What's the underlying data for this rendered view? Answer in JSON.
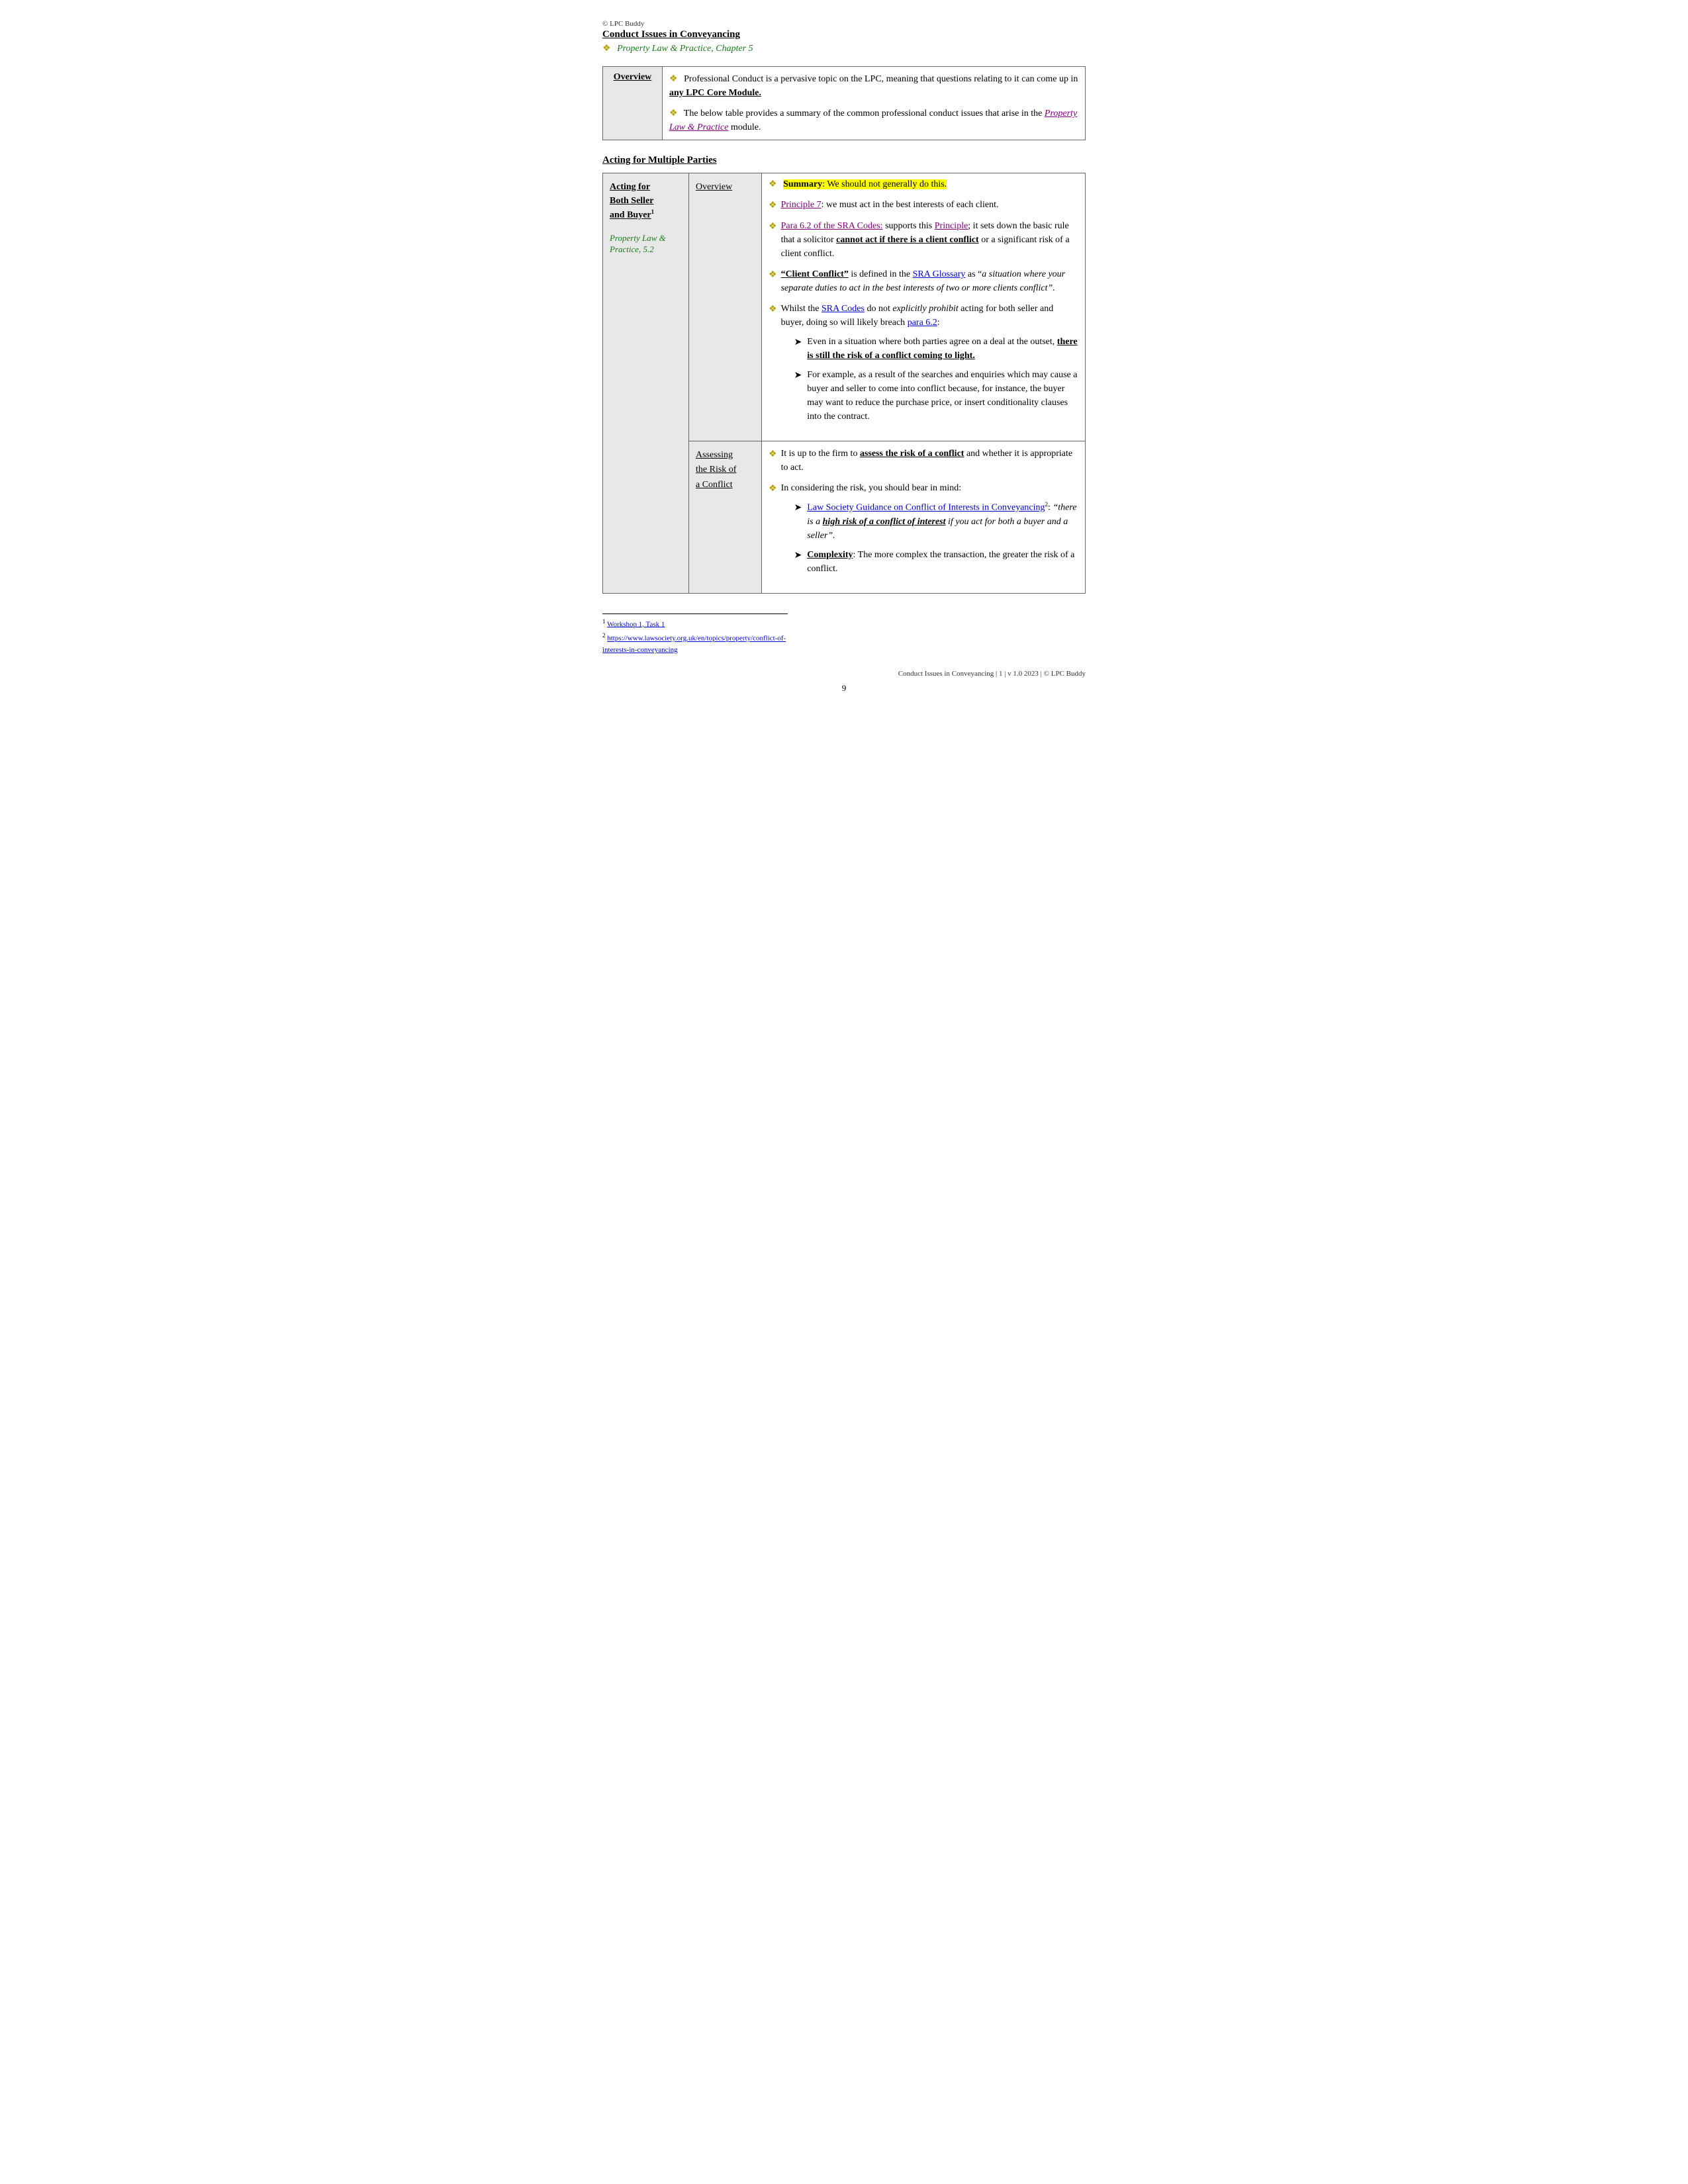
{
  "copyright": "© LPC Buddy",
  "main_title": "Conduct Issues in Conveyancing",
  "subtitle": {
    "bullet": "❖",
    "link_text": "Property Law & Practice, Chapter 5",
    "link_href": "#"
  },
  "overview": {
    "label": "Overview",
    "items": [
      {
        "text_parts": [
          {
            "text": "Professional Conduct is a pervasive topic on the LPC, meaning that questions relating to it can come up in ",
            "bold": false
          },
          {
            "text": "any LPC Core Module.",
            "bold": true,
            "underline": true
          }
        ]
      },
      {
        "text_parts": [
          {
            "text": "The below table provides a summary of the common professional conduct issues that arise in the ",
            "bold": false
          },
          {
            "text": "Property Law & Practice",
            "italic": true,
            "link": true
          },
          {
            "text": " module.",
            "bold": false
          }
        ]
      }
    ]
  },
  "acting_section_heading": "Acting for Multiple Parties",
  "table": {
    "row1": {
      "left": {
        "heading_line1": "Acting for",
        "heading_line2": "Both Seller",
        "heading_line3": "and Buyer",
        "footnote_ref": "1",
        "link_text": "Property Law & Practice, 5.2",
        "link_href": "#"
      },
      "middle_top": "Overview",
      "right_top": {
        "summary": "Summary: We should not generally do this.",
        "bullets": [
          {
            "id": "b1",
            "content": "Principle 7: we must act in the best interests of each client.",
            "link_text": "Principle 7",
            "link_href": "#"
          },
          {
            "id": "b2",
            "parts": [
              {
                "text": "Para 6.2 of the SRA Codes:",
                "link": true,
                "link_type": "purple"
              },
              {
                "text": " supports this "
              },
              {
                "text": "Principle",
                "link": true,
                "link_type": "purple"
              },
              {
                "text": "; it sets down the basic rule that a solicitor "
              },
              {
                "text": "cannot act if there is a client conflict",
                "bold": true,
                "underline": true
              },
              {
                "text": " or a significant risk of a client conflict."
              }
            ]
          },
          {
            "id": "b3",
            "parts": [
              {
                "text": "“Client Conflict”",
                "bold": true,
                "underline": true
              },
              {
                "text": " is defined in the "
              },
              {
                "text": "SRA Glossary",
                "link": true,
                "link_type": "blue"
              },
              {
                "text": " as “"
              },
              {
                "text": "a situation where your separate duties to act in the best interests of two or more clients conflict”.",
                "italic": true
              }
            ]
          },
          {
            "id": "b4",
            "parts": [
              {
                "text": "Whilst the "
              },
              {
                "text": "SRA Codes",
                "link": true,
                "link_type": "blue"
              },
              {
                "text": " do not "
              },
              {
                "text": "explicitly prohibit",
                "italic": true
              },
              {
                "text": " acting for both seller and buyer, doing so will likely breach "
              },
              {
                "text": "para 6.2",
                "link": true,
                "link_type": "blue"
              },
              {
                "text": ":"
              }
            ],
            "arrows": [
              {
                "text_parts": [
                  {
                    "text": "Even in a situation where both parties agree on a deal at the outset, "
                  },
                  {
                    "text": "there is still the risk of a conflict coming to light.",
                    "bold": true,
                    "underline": true
                  }
                ]
              },
              {
                "text_parts": [
                  {
                    "text": "For example, as a result of the searches and enquiries which may cause a buyer and seller to come into conflict because, for instance, the buyer may want to reduce the purchase price, or insert conditionality clauses into the contract."
                  }
                ]
              }
            ]
          }
        ]
      },
      "middle_bottom": {
        "line1": "Assessing",
        "line2": "the Risk of",
        "line3": "a Conflict"
      },
      "right_bottom": {
        "bullets": [
          {
            "id": "rb1",
            "parts": [
              {
                "text": "It is up to the firm to "
              },
              {
                "text": "assess the risk of a conflict",
                "bold": true,
                "underline": true
              },
              {
                "text": " and whether it is appropriate to act."
              }
            ]
          },
          {
            "id": "rb2",
            "parts": [
              {
                "text": "In considering the risk, you should bear in mind:"
              }
            ],
            "arrows": [
              {
                "text_parts": [
                  {
                    "text": "Law Society Guidance on Conflict of Interests in Conveyancing",
                    "link": true,
                    "link_type": "blue"
                  },
                  {
                    "text": "2",
                    "sup": true
                  },
                  {
                    "text": ": “"
                  },
                  {
                    "text": "there is a ",
                    "italic": true
                  },
                  {
                    "text": "high risk of a conflict of interest",
                    "bold": true,
                    "italic": true,
                    "underline": true
                  },
                  {
                    "text": " if you act for both a buyer and a seller”.",
                    "italic": true
                  }
                ]
              },
              {
                "text_parts": [
                  {
                    "text": "Complexity",
                    "bold": true,
                    "underline": true
                  },
                  {
                    "text": ": The more complex the transaction, the greater the risk of a conflict."
                  }
                ]
              }
            ]
          }
        ]
      }
    }
  },
  "footnotes": [
    {
      "number": "1",
      "text": "Workshop 1, Task 1",
      "link": true,
      "href": "#"
    },
    {
      "number": "2",
      "text": "https://www.lawsociety.org.uk/en/topics/property/conflict-of-interests-in-conveyancing",
      "link": true,
      "href": "https://www.lawsociety.org.uk/en/topics/property/conflict-of-interests-in-conveyancing"
    }
  ],
  "footer": {
    "text": "Conduct Issues in Conveyancing | 1 | v 1.0 2023 | © LPC Buddy",
    "page": "9"
  }
}
